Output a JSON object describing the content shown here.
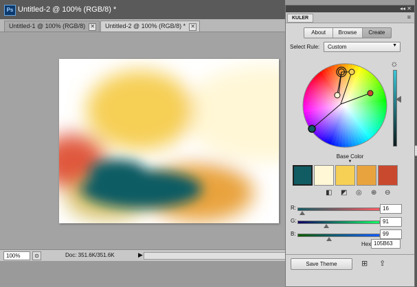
{
  "document": {
    "title": "Untitled-2 @ 100% (RGB/8) *",
    "app_icon_label": "Ps",
    "tabs": [
      {
        "label": "Untitled-1 @ 100% (RGB/8)",
        "close": "✕",
        "active": false
      },
      {
        "label": "Untitled-2 @ 100% (RGB/8) *",
        "close": "✕",
        "active": true
      }
    ],
    "zoom": "100%",
    "doc_size": "Doc: 351.6K/351.6K",
    "status_arrow": "▶"
  },
  "kuler": {
    "panel_title": "KULER",
    "top_controls": "◂◂ ✕",
    "menu_icon": "≡",
    "tabs": [
      "About",
      "Browse",
      "Create"
    ],
    "selected_tab": "Create",
    "select_rule_label": "Select Rule:",
    "select_rule_value": "Custom",
    "base_color_label": "Base Color",
    "base_color_arrow": "▼",
    "swatches": [
      "#115B63",
      "#FFF7D6",
      "#F6CF55",
      "#E9A33E",
      "#C9492F"
    ],
    "selected_swatch_index": 0,
    "rgb": {
      "r_label": "R:",
      "r": "16",
      "r_fraction": 0.063,
      "g_label": "G:",
      "g": "91",
      "g_fraction": 0.357,
      "b_label": "B:",
      "b": "99",
      "b_fraction": 0.388
    },
    "brightness_fraction": 0.39,
    "hex_label": "Hex:",
    "hex": "105B63",
    "save_button": "Save Theme"
  },
  "colors": {
    "swatch_blue": "#115B63",
    "swatch_cream": "#FFF7D6",
    "swatch_yellow": "#F6CF55",
    "swatch_orange": "#E9A33E",
    "swatch_red": "#C9492F"
  },
  "icons": {
    "sun": "sun-icon",
    "add_to_swatches": "add-to-swatches-icon",
    "upload": "upload-theme-icon"
  }
}
